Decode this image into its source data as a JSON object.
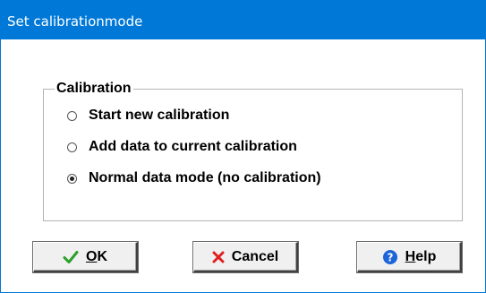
{
  "window": {
    "title": "Set calibrationmode"
  },
  "calibration_group": {
    "legend": "Calibration",
    "options": [
      {
        "label": "Start new calibration",
        "selected": false
      },
      {
        "label": "Add data to current calibration",
        "selected": false
      },
      {
        "label": "Normal data mode (no calibration)",
        "selected": true
      }
    ]
  },
  "buttons": {
    "ok": {
      "accel": "O",
      "rest": "K",
      "icon": "checkmark-icon",
      "icon_color": "#2aa02a"
    },
    "cancel": {
      "label": "Cancel",
      "icon": "x-icon",
      "icon_color": "#e02020"
    },
    "help": {
      "accel": "H",
      "rest": "elp",
      "icon": "help-icon",
      "icon_color": "#1c64d8"
    }
  }
}
